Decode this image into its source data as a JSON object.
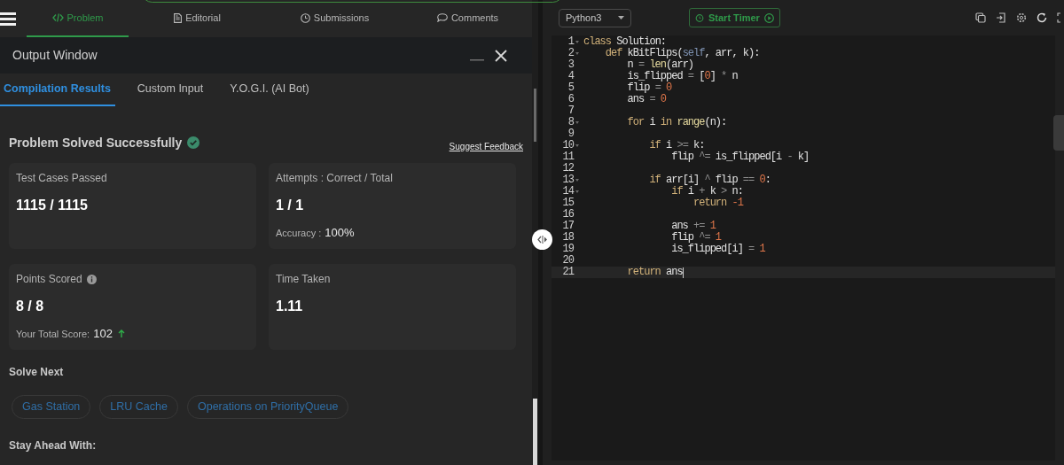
{
  "nav": {
    "tabs": [
      {
        "label": "Problem",
        "selected": true
      },
      {
        "label": "Editorial",
        "selected": false
      },
      {
        "label": "Submissions",
        "selected": false
      },
      {
        "label": "Comments",
        "selected": false
      }
    ]
  },
  "output_window": {
    "title": "Output Window",
    "tabs": [
      {
        "label": "Compilation Results",
        "selected": true
      },
      {
        "label": "Custom Input",
        "selected": false
      },
      {
        "label": "Y.O.G.I. (AI Bot)",
        "selected": false
      }
    ],
    "heading": "Problem Solved Successfully",
    "feedback_link": "Suggest Feedback",
    "cards": [
      {
        "label": "Test Cases Passed",
        "value": "1115 / 1115",
        "info_icon": false
      },
      {
        "label": "Attempts : Correct / Total",
        "value": "1 / 1",
        "note_label": "Accuracy :",
        "note_value": "100%",
        "info_icon": false,
        "score_rising": false
      },
      {
        "label": "Points Scored",
        "value": "8 / 8",
        "note_label": "Your Total Score:",
        "note_value": "102",
        "info_icon": true,
        "score_rising": true
      },
      {
        "label": "Time Taken",
        "value": "1.11",
        "info_icon": false
      }
    ],
    "solve_next": {
      "heading": "Solve Next",
      "problems": [
        "Gas Station",
        "LRU Cache",
        "Operations on PriorityQueue"
      ]
    },
    "stay_ahead": {
      "heading": "Stay Ahead With:"
    }
  },
  "editor": {
    "language": "Python3",
    "timer_button": "Start Timer",
    "lines": [
      {
        "number": "1",
        "fold": true,
        "current": false,
        "tokens": [
          {
            "kind": "keyword",
            "text": "class"
          },
          {
            "kind": "plain",
            "text": " Solution:"
          }
        ]
      },
      {
        "number": "2",
        "fold": true,
        "current": false,
        "tokens": [
          {
            "kind": "keyword",
            "text": "    def"
          },
          {
            "kind": "plain",
            "text": " kBitFlips("
          },
          {
            "kind": "self",
            "text": "self"
          },
          {
            "kind": "plain",
            "text": ", arr, k):"
          }
        ]
      },
      {
        "number": "3",
        "fold": false,
        "current": false,
        "tokens": [
          {
            "kind": "plain",
            "text": "        n "
          },
          {
            "kind": "operator",
            "text": "="
          },
          {
            "kind": "builtin",
            "text": " len"
          },
          {
            "kind": "plain",
            "text": "(arr)"
          }
        ]
      },
      {
        "number": "4",
        "fold": false,
        "current": false,
        "tokens": [
          {
            "kind": "plain",
            "text": "        is_flipped "
          },
          {
            "kind": "operator",
            "text": "="
          },
          {
            "kind": "plain",
            "text": " ["
          },
          {
            "kind": "number",
            "text": "0"
          },
          {
            "kind": "plain",
            "text": "] "
          },
          {
            "kind": "operator",
            "text": "*"
          },
          {
            "kind": "plain",
            "text": " n"
          }
        ]
      },
      {
        "number": "5",
        "fold": false,
        "current": false,
        "tokens": [
          {
            "kind": "plain",
            "text": "        flip "
          },
          {
            "kind": "operator",
            "text": "="
          },
          {
            "kind": "number",
            "text": " 0"
          }
        ]
      },
      {
        "number": "6",
        "fold": false,
        "current": false,
        "tokens": [
          {
            "kind": "plain",
            "text": "        ans "
          },
          {
            "kind": "operator",
            "text": "="
          },
          {
            "kind": "number",
            "text": " 0"
          }
        ]
      },
      {
        "number": "7",
        "fold": false,
        "current": false
      },
      {
        "number": "8",
        "fold": true,
        "current": false,
        "tokens": [
          {
            "kind": "keyword",
            "text": "        for"
          },
          {
            "kind": "plain",
            "text": " i "
          },
          {
            "kind": "keyword",
            "text": "in"
          },
          {
            "kind": "builtin",
            "text": " range"
          },
          {
            "kind": "plain",
            "text": "(n):"
          }
        ]
      },
      {
        "number": "9",
        "fold": false,
        "current": false
      },
      {
        "number": "10",
        "fold": true,
        "current": false,
        "tokens": [
          {
            "kind": "keyword",
            "text": "            if"
          },
          {
            "kind": "plain",
            "text": " i "
          },
          {
            "kind": "operator",
            "text": ">="
          },
          {
            "kind": "plain",
            "text": " k:"
          }
        ]
      },
      {
        "number": "11",
        "fold": false,
        "current": false,
        "tokens": [
          {
            "kind": "plain",
            "text": "                flip "
          },
          {
            "kind": "operator",
            "text": "^="
          },
          {
            "kind": "plain",
            "text": " is_flipped[i "
          },
          {
            "kind": "operator",
            "text": "-"
          },
          {
            "kind": "plain",
            "text": " k]"
          }
        ]
      },
      {
        "number": "12",
        "fold": false,
        "current": false
      },
      {
        "number": "13",
        "fold": true,
        "current": false,
        "tokens": [
          {
            "kind": "keyword",
            "text": "            if"
          },
          {
            "kind": "plain",
            "text": " arr[i] "
          },
          {
            "kind": "operator",
            "text": "^"
          },
          {
            "kind": "plain",
            "text": " flip "
          },
          {
            "kind": "operator",
            "text": "=="
          },
          {
            "kind": "number",
            "text": " 0"
          },
          {
            "kind": "plain",
            "text": ":"
          }
        ]
      },
      {
        "number": "14",
        "fold": true,
        "current": false,
        "tokens": [
          {
            "kind": "keyword",
            "text": "                if"
          },
          {
            "kind": "plain",
            "text": " i "
          },
          {
            "kind": "operator",
            "text": "+"
          },
          {
            "kind": "plain",
            "text": " k "
          },
          {
            "kind": "operator",
            "text": ">"
          },
          {
            "kind": "plain",
            "text": " n:"
          }
        ]
      },
      {
        "number": "15",
        "fold": false,
        "current": false,
        "tokens": [
          {
            "kind": "keyword",
            "text": "                    return"
          },
          {
            "kind": "number",
            "text": " -1"
          }
        ]
      },
      {
        "number": "16",
        "fold": false,
        "current": false
      },
      {
        "number": "17",
        "fold": false,
        "current": false,
        "tokens": [
          {
            "kind": "plain",
            "text": "                ans "
          },
          {
            "kind": "operator",
            "text": "+="
          },
          {
            "kind": "number",
            "text": " 1"
          }
        ]
      },
      {
        "number": "18",
        "fold": false,
        "current": false,
        "tokens": [
          {
            "kind": "plain",
            "text": "                flip "
          },
          {
            "kind": "operator",
            "text": "^="
          },
          {
            "kind": "number",
            "text": " 1"
          }
        ]
      },
      {
        "number": "19",
        "fold": false,
        "current": false,
        "tokens": [
          {
            "kind": "plain",
            "text": "                is_flipped[i] "
          },
          {
            "kind": "operator",
            "text": "="
          },
          {
            "kind": "number",
            "text": " 1"
          }
        ]
      },
      {
        "number": "20",
        "fold": false,
        "current": false
      },
      {
        "number": "21",
        "fold": false,
        "current": true,
        "tokens": [
          {
            "kind": "keyword",
            "text": "        return"
          },
          {
            "kind": "plain",
            "text": " ans"
          }
        ]
      }
    ]
  }
}
